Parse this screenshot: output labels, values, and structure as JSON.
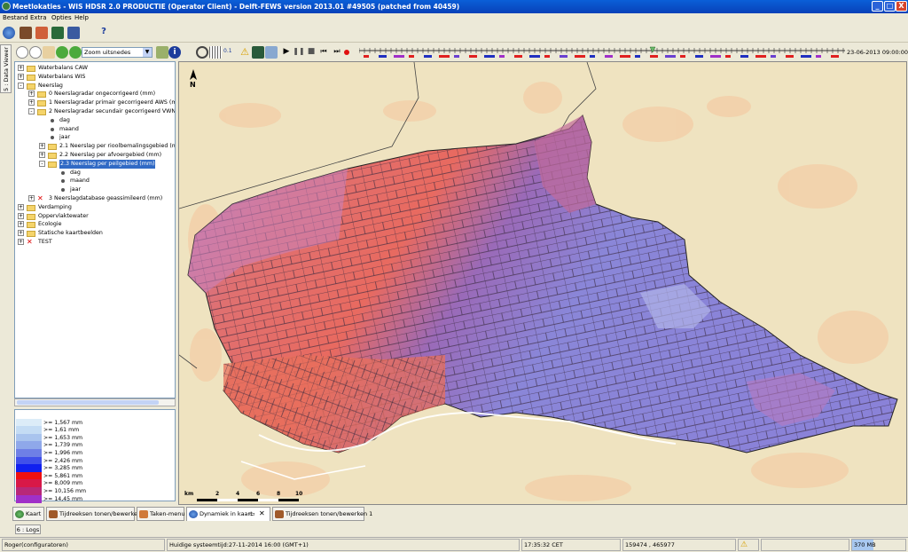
{
  "window": {
    "title": "Meetlokaties - WIS HDSR 2.0 PRODUCTIE  (Operator Client) - Delft-FEWS version 2013.01 #49505 (patched from 40459)",
    "buttons": [
      "_",
      "□",
      "X"
    ]
  },
  "menu": [
    "Bestand",
    "Extra",
    "Opties",
    "Help"
  ],
  "toolbar": {
    "zoom_select": "Zoom uitsnedes",
    "date": "23-06-2013 09:00:00",
    "step_label": "0.1"
  },
  "side_tab": "5 : Data Viewer",
  "tree": [
    {
      "label": "Waterbalans CAW",
      "level": 0,
      "icon": "folder",
      "exp": "+"
    },
    {
      "label": "Waterbalans WIS",
      "level": 0,
      "icon": "folder",
      "exp": "+"
    },
    {
      "label": "Neerslag",
      "level": 0,
      "icon": "folder-open",
      "exp": "-"
    },
    {
      "label": "0 Neerslagradar ongecorrigeerd (mm)",
      "level": 1,
      "icon": "folder",
      "exp": "+"
    },
    {
      "label": "1 Neerslagradar primair gecorrigeerd AWS (mm)",
      "level": 1,
      "icon": "folder",
      "exp": "+"
    },
    {
      "label": "2 Neerslagradar secundair gecorrigeerd VWN 8-8",
      "level": 1,
      "icon": "folder-open",
      "exp": "-"
    },
    {
      "label": "dag",
      "level": 2,
      "icon": "dot"
    },
    {
      "label": "maand",
      "level": 2,
      "icon": "dot"
    },
    {
      "label": "jaar",
      "level": 2,
      "icon": "dot"
    },
    {
      "label": "2.1 Neerslag per rioolbemalingsgebied (mm)",
      "level": 2,
      "icon": "folder",
      "exp": "+"
    },
    {
      "label": "2.2 Neerslag per afvoergebied (mm)",
      "level": 2,
      "icon": "folder",
      "exp": "+"
    },
    {
      "label": "2.3 Neerslag per peilgebied (mm)",
      "level": 2,
      "icon": "folder-open",
      "exp": "-",
      "selected": true
    },
    {
      "label": "dag",
      "level": 3,
      "icon": "dot"
    },
    {
      "label": "maand",
      "level": 3,
      "icon": "dot"
    },
    {
      "label": "jaar",
      "level": 3,
      "icon": "dot"
    },
    {
      "label": "3 Neerslagdatabase geassimileerd (mm)",
      "level": 1,
      "icon": "x",
      "exp": "+"
    },
    {
      "label": "Verdamping",
      "level": 0,
      "icon": "folder",
      "exp": "+"
    },
    {
      "label": "Oppervlaktewater",
      "level": 0,
      "icon": "folder",
      "exp": "+"
    },
    {
      "label": "Ecologie",
      "level": 0,
      "icon": "folder",
      "exp": "+"
    },
    {
      "label": "Statische kaartbeelden",
      "level": 0,
      "icon": "folder",
      "exp": "+"
    },
    {
      "label": "TEST",
      "level": 0,
      "icon": "x",
      "exp": "+"
    }
  ],
  "legend": [
    {
      "label": "",
      "color": "#ffffff"
    },
    {
      "label": ">= 1,567 mm",
      "color": "#dcecf8"
    },
    {
      "label": ">= 1,61 mm",
      "color": "#c4dcf4"
    },
    {
      "label": ">= 1,653 mm",
      "color": "#a9c4ee"
    },
    {
      "label": ">= 1,739 mm",
      "color": "#8fa8ea"
    },
    {
      "label": ">= 1,996 mm",
      "color": "#6f80e6"
    },
    {
      "label": ">= 2,426 mm",
      "color": "#4050ea"
    },
    {
      "label": ">= 3,285 mm",
      "color": "#1020f0"
    },
    {
      "label": ">= 5,861 mm",
      "color": "#ee1010"
    },
    {
      "label": ">= 8,009 mm",
      "color": "#d81848"
    },
    {
      "label": ">= 10,156 mm",
      "color": "#b82878"
    },
    {
      "label": ">= 14,45 mm",
      "color": "#a030c8"
    }
  ],
  "map": {
    "north": "N",
    "scale_labels": [
      "km",
      "2",
      "4",
      "6",
      "8",
      "10"
    ]
  },
  "bottom_tabs": [
    {
      "label": "Kaart",
      "active": false
    },
    {
      "label": "Tijdreeksen tonen/bewerken",
      "active": false
    },
    {
      "label": "Taken-menu",
      "active": false
    },
    {
      "label": "Dynamiek in kaart",
      "active": true
    },
    {
      "label": "Tijdreeksen tonen/bewerken 1",
      "active": false
    }
  ],
  "logs_tab": "6 : Logs",
  "status": {
    "user": "Roger(configuratoren)",
    "systemtime": "Huidige systeemtijd:27-11-2014 16:00 (GMT+1)",
    "clock": "17:35:32 CET",
    "coords": "159474 , 465977",
    "memory": "370 MB"
  }
}
